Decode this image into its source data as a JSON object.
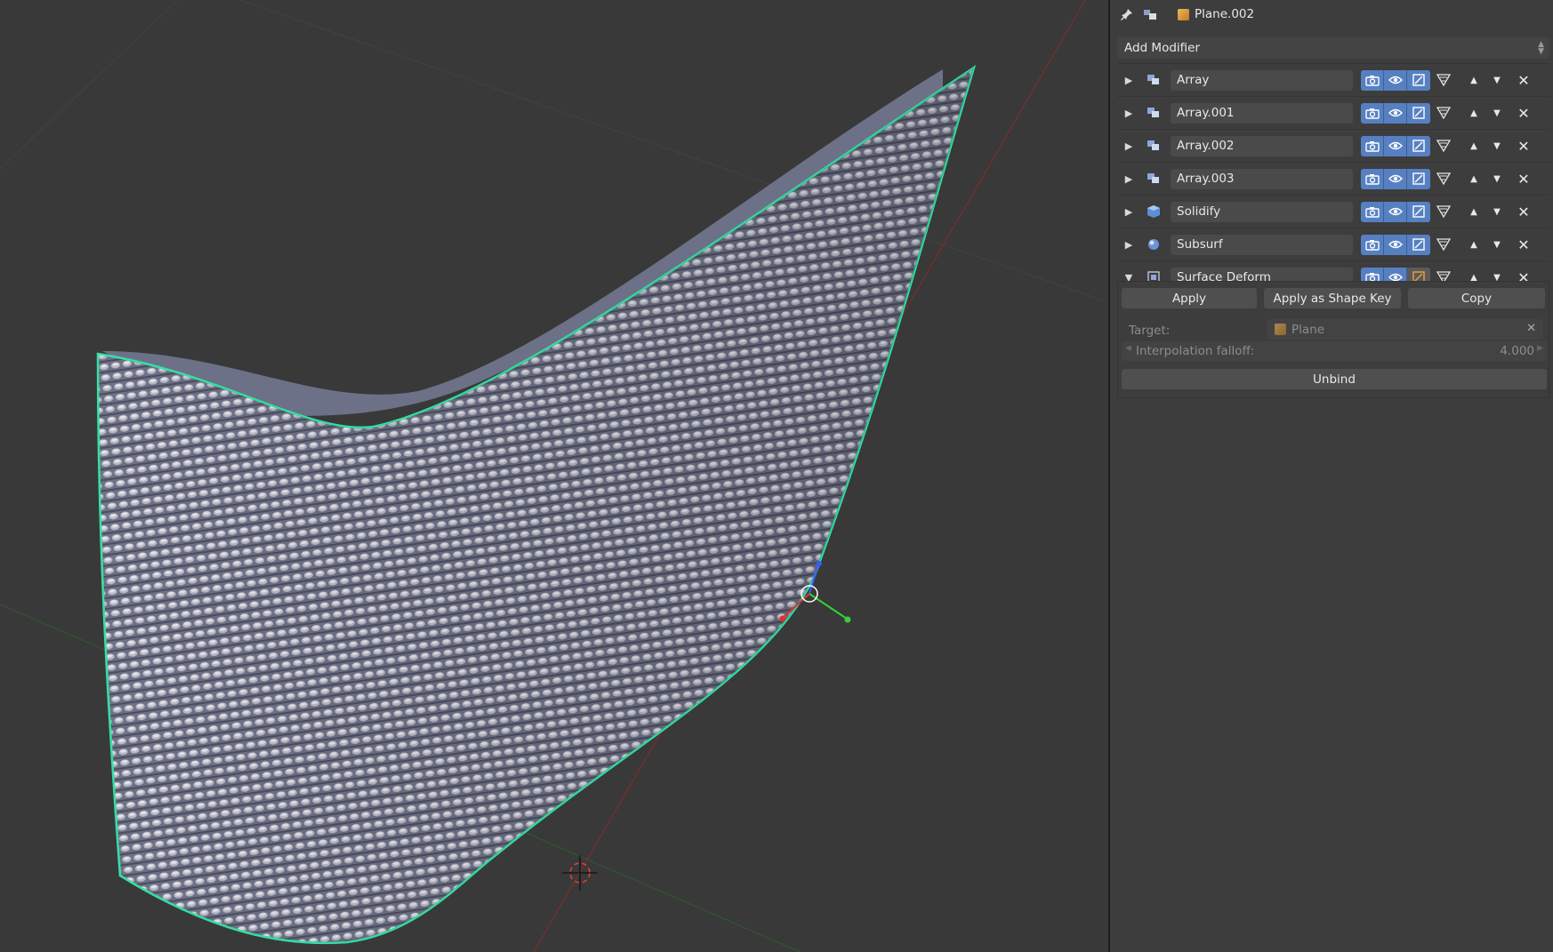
{
  "header": {
    "object_name": "Plane.002",
    "icons": [
      "pin-icon",
      "context-link-icon",
      "object-cube-icon"
    ]
  },
  "add_modifier_label": "Add Modifier",
  "modifiers": [
    {
      "name": "Array",
      "type_icon": "array-icon",
      "expanded": false,
      "editmode_on": true
    },
    {
      "name": "Array.001",
      "type_icon": "array-icon",
      "expanded": false,
      "editmode_on": true
    },
    {
      "name": "Array.002",
      "type_icon": "array-icon",
      "expanded": false,
      "editmode_on": true
    },
    {
      "name": "Array.003",
      "type_icon": "array-icon",
      "expanded": false,
      "editmode_on": true
    },
    {
      "name": "Solidify",
      "type_icon": "solidify-icon",
      "expanded": false,
      "editmode_on": true
    },
    {
      "name": "Subsurf",
      "type_icon": "subsurf-icon",
      "expanded": false,
      "editmode_on": true
    },
    {
      "name": "Surface Deform",
      "type_icon": "surface-deform-icon",
      "expanded": true,
      "editmode_on": false
    }
  ],
  "surface_deform": {
    "apply_label": "Apply",
    "apply_shape_key_label": "Apply as Shape Key",
    "copy_label": "Copy",
    "target_label": "Target:",
    "target_value": "Plane",
    "falloff_label": "Interpolation falloff:",
    "falloff_value": "4.000",
    "unbind_label": "Unbind"
  },
  "colors": {
    "toggle_active": "#5680c2",
    "mesh_outline": "#35e0a4",
    "background": "#393939"
  }
}
